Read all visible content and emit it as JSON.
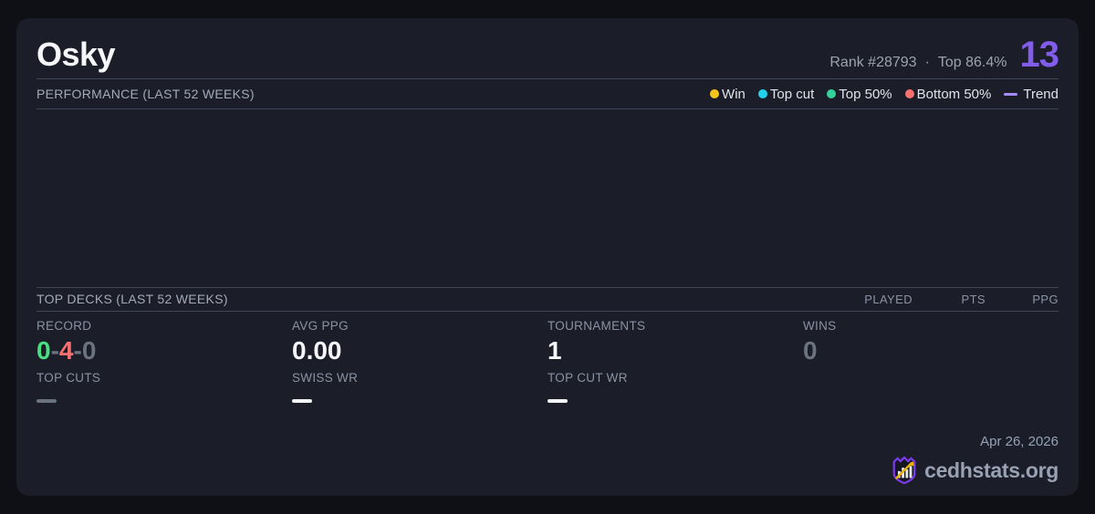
{
  "header": {
    "player_name": "Osky",
    "rank_text": "Rank #28793",
    "separator": "·",
    "top_percent": "Top 86.4%",
    "score": "13",
    "score_color": "#825ceb"
  },
  "performance": {
    "title": "PERFORMANCE (LAST 52 WEEKS)",
    "legend": [
      {
        "label": "Win",
        "color": "#f5c51c",
        "marker": "dot"
      },
      {
        "label": "Top cut",
        "color": "#22d3ee",
        "marker": "dot"
      },
      {
        "label": "Top 50%",
        "color": "#34d399",
        "marker": "dot"
      },
      {
        "label": "Bottom 50%",
        "color": "#f87171",
        "marker": "dot"
      },
      {
        "label": "Trend",
        "color": "#a78bfa",
        "marker": "line"
      }
    ],
    "chart_empty": true
  },
  "top_decks": {
    "title": "TOP DECKS (LAST 52 WEEKS)",
    "columns": [
      "PLAYED",
      "PTS",
      "PPG"
    ]
  },
  "stats": {
    "record": {
      "label": "RECORD",
      "wins": "0",
      "losses": "4",
      "draws": "0",
      "separator": "-",
      "wins_color": "#4ade80",
      "losses_color": "#f87171",
      "draws_color": "#6b7280"
    },
    "avg_ppg": {
      "label": "AVG PPG",
      "value": "0.00"
    },
    "tournaments": {
      "label": "TOURNAMENTS",
      "value": "1"
    },
    "wins": {
      "label": "WINS",
      "value": "0",
      "value_color": "#6b7280"
    },
    "top_cuts": {
      "label": "TOP CUTS",
      "dash_color": "#6b7280"
    },
    "swiss_wr": {
      "label": "SWISS WR",
      "dash_color": "#f3f4f6"
    },
    "top_cut_wr": {
      "label": "TOP CUT WR",
      "dash_color": "#f3f4f6"
    }
  },
  "footer": {
    "date": "Apr 26, 2026",
    "site": "cedhstats.org"
  },
  "colors": {
    "page_bg": "#0e1016",
    "card_bg": "#1b1e28",
    "divider": "#3e4557",
    "accent_purple": "#825ceb",
    "logo_purple": "#7c3aed",
    "logo_gold": "#eab308"
  }
}
